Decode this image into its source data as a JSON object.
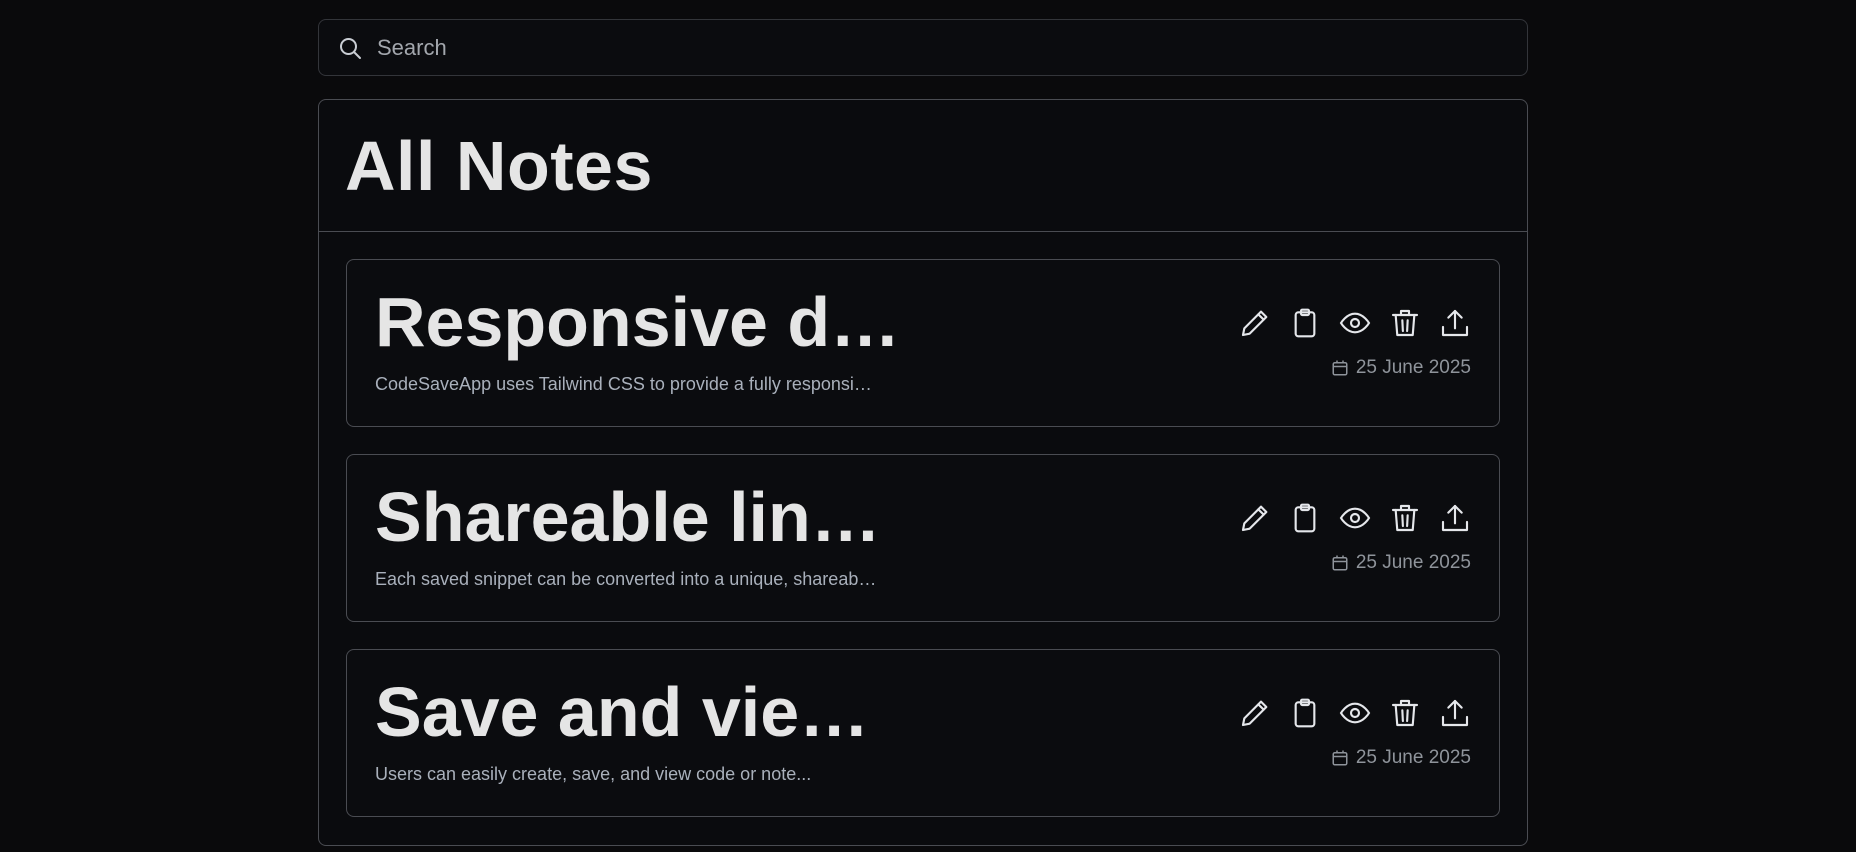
{
  "search": {
    "placeholder": "Search",
    "icon": "search-icon"
  },
  "panel": {
    "title": "All Notes"
  },
  "notes": [
    {
      "title": "Responsive d…",
      "description": "CodeSaveApp uses Tailwind CSS to provide a fully responsi…",
      "date": "25 June 2025"
    },
    {
      "title": "Shareable lin…",
      "description": "Each saved snippet can be converted into a unique, shareab…",
      "date": "25 June 2025"
    },
    {
      "title": "Save and vie…",
      "description": "Users can easily create, save, and view code or note...",
      "date": "25 June 2025"
    }
  ],
  "actions": [
    "pencil-icon",
    "clipboard-icon",
    "eye-icon",
    "trash-icon",
    "share-icon"
  ],
  "colors": {
    "background": "#0a0a0c",
    "border": "#4a4c52",
    "text": "#e5e5e5",
    "muted": "#a9b0bb"
  }
}
